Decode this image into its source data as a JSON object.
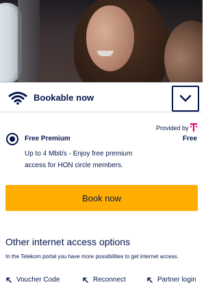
{
  "header": {
    "title": "Bookable now",
    "toggle_icon": "chevron-down-icon"
  },
  "option": {
    "provided_by": "Provided by",
    "provider_logo": "telekom-t-icon",
    "name": "Free Premium",
    "price": "Free",
    "description": "Up to 4 Mbit/s - Enjoy free premium access for HON circle members.",
    "selected": true
  },
  "book_button": {
    "label": "Book now"
  },
  "other": {
    "title": "Other internet access options",
    "description": "In the Telekom portal you have more possibilities to get internet access."
  },
  "links": [
    {
      "label": "Voucher Code",
      "icon": "arrow-up-left-icon"
    },
    {
      "label": "Reconnect",
      "icon": "arrow-up-left-icon"
    },
    {
      "label": "Partner login",
      "icon": "arrow-up-left-icon"
    }
  ],
  "colors": {
    "primary": "#05164d",
    "accent": "#ffad00",
    "telekom": "#e20074"
  }
}
